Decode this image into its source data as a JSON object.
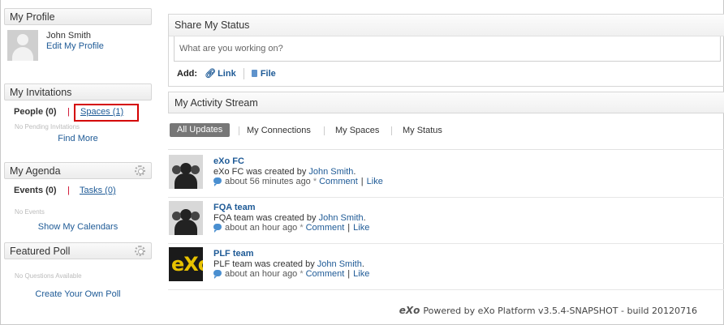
{
  "profile": {
    "header": "My Profile",
    "name": "John Smith",
    "edit_link": "Edit My Profile"
  },
  "invitations": {
    "header": "My Invitations",
    "people_tab": "People (0)",
    "separator": "|",
    "spaces_tab": "Spaces (1)",
    "empty_note": "No Pending Invitations",
    "find_more": "Find More"
  },
  "agenda": {
    "header": "My Agenda",
    "events_tab": "Events (0)",
    "separator": "|",
    "tasks_tab": "Tasks (0)",
    "empty_note": "No Events",
    "show_calendars": "Show My Calendars"
  },
  "poll": {
    "header": "Featured Poll",
    "empty_note": "No Questions Available",
    "create_link": "Create Your Own Poll"
  },
  "share_status": {
    "header": "Share My Status",
    "placeholder": "What are you working on?",
    "add_label": "Add:",
    "link_label": "Link",
    "file_label": "File"
  },
  "activity_stream": {
    "header": "My Activity Stream",
    "filters": [
      "All Updates",
      "My Connections",
      "My Spaces",
      "My Status"
    ],
    "active_filter": "All Updates",
    "items": [
      {
        "title": "eXo FC",
        "text_prefix": "eXo FC was created by ",
        "author": "John Smith",
        "text_suffix": ".",
        "time": "about 56 minutes ago",
        "comment_label": "Comment",
        "like_label": "Like",
        "avatar": "group-avatar"
      },
      {
        "title": "FQA team",
        "text_prefix": "FQA team was created by ",
        "author": "John Smith",
        "text_suffix": ".",
        "time": "about an hour ago",
        "comment_label": "Comment",
        "like_label": "Like",
        "avatar": "group-avatar"
      },
      {
        "title": "PLF team",
        "text_prefix": "PLF team was created by ",
        "author": "John Smith",
        "text_suffix": ".",
        "time": "about an hour ago",
        "comment_label": "Comment",
        "like_label": "Like",
        "avatar": "exo-logo"
      }
    ]
  },
  "footer": {
    "logo": "eXo",
    "text": "Powered by eXo Platform v3.5.4-SNAPSHOT - build 20120716"
  },
  "colors": {
    "link": "#1e5a96",
    "highlight_box": "#d40000",
    "active_filter_bg": "#777777"
  }
}
